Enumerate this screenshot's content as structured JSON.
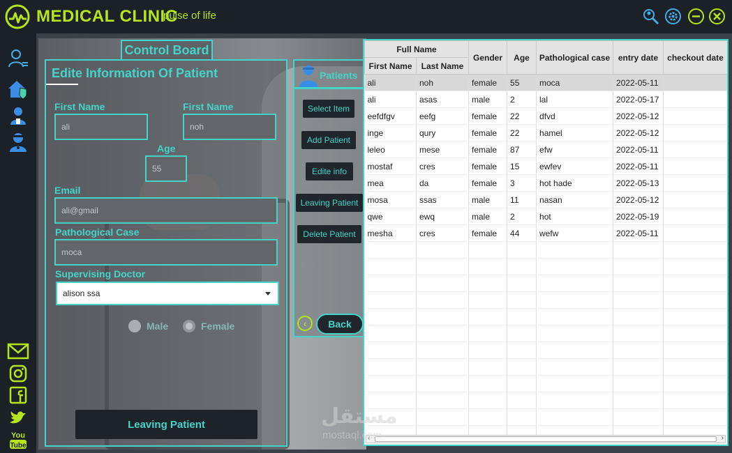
{
  "app": {
    "title": "MEDICAL CLINIC",
    "subtitle": "pulse of life"
  },
  "colors": {
    "accent": "#45d4c9",
    "brand": "#b5e61d",
    "background": "#1c2128"
  },
  "window_controls": [
    "search-user-icon",
    "gear-icon",
    "minimize-icon",
    "close-icon"
  ],
  "sidebar": {
    "top_icons": [
      "user-list-icon",
      "home-shield-icon",
      "doctor-icon",
      "patient-icon"
    ],
    "bottom_icons": [
      "mail-icon",
      "instagram-icon",
      "facebook-icon",
      "twitter-icon",
      "youtube-icon"
    ],
    "youtube_label": "You Tube"
  },
  "control_board": {
    "label": "Control Board"
  },
  "edit_form": {
    "title": "Edite Information Of Patient",
    "first_name_label": "First Name",
    "first_name_value": "ali",
    "last_name_label": "First Name",
    "last_name_value": "noh",
    "age_label": "Age",
    "age_value": "55",
    "email_label": "Email",
    "email_value": "ali@gmail",
    "pathological_label": "Pathological Case",
    "pathological_value": "moca",
    "doctor_label": "Supervising Doctor",
    "doctor_value": "alison ssa",
    "gender_male": "Male",
    "gender_female": "Female",
    "gender_selected": "Female",
    "submit_label": "Leaving Patient"
  },
  "patients_panel": {
    "title": "Patients",
    "buttons": [
      "Select Item",
      "Add Patient",
      "Edite info",
      "Leaving Patient",
      "Delete Patient"
    ],
    "back_label": "Back"
  },
  "table": {
    "group_header": "Full Name",
    "columns": [
      "First Name",
      "Last Name",
      "Gender",
      "Age",
      "Pathological case",
      "entry date",
      "checkout date"
    ],
    "rows": [
      [
        "ali",
        "noh",
        "female",
        "55",
        "moca",
        "2022-05-11",
        ""
      ],
      [
        "ali",
        "asas",
        "male",
        "2",
        "lal",
        "2022-05-17",
        ""
      ],
      [
        "eefdfgv",
        "eefg",
        "female",
        "22",
        "dfvd",
        "2022-05-12",
        ""
      ],
      [
        "inge",
        "qury",
        "female",
        "22",
        "hamel",
        "2022-05-12",
        ""
      ],
      [
        "leleo",
        "mese",
        "female",
        "87",
        "efw",
        "2022-05-11",
        ""
      ],
      [
        "mostaf",
        "cres",
        "female",
        "15",
        "ewfev",
        "2022-05-11",
        ""
      ],
      [
        "mea",
        "da",
        "female",
        "3",
        "hot hade",
        "2022-05-13",
        ""
      ],
      [
        "mosa",
        "ssas",
        "male",
        "11",
        "nasan",
        "2022-05-12",
        ""
      ],
      [
        "qwe",
        "ewq",
        "male",
        "2",
        "hot",
        "2022-05-19",
        ""
      ],
      [
        "mesha",
        "cres",
        "female",
        "44",
        "wefw",
        "2022-05-11",
        ""
      ]
    ],
    "selected_row": 0
  },
  "watermark": {
    "arabic": "مستقل",
    "latin": "mostaql.com"
  }
}
